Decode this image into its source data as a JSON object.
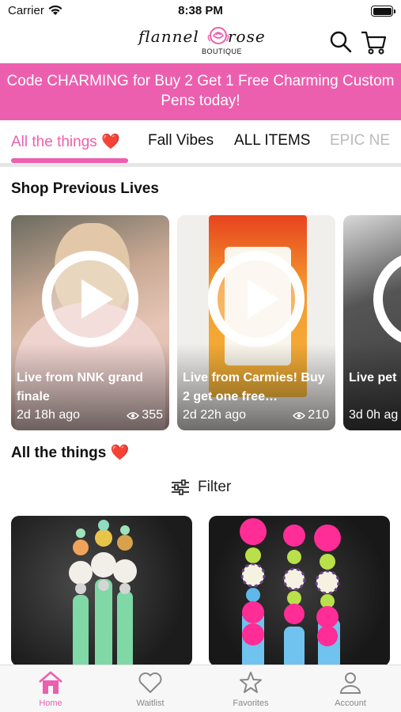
{
  "status_bar": {
    "carrier": "Carrier",
    "time": "8:38 PM"
  },
  "header": {
    "logo": {
      "left": "flannel",
      "right": "rose",
      "sub": "BOUTIQUE"
    }
  },
  "promo": {
    "text": "Code CHARMING for Buy 2 Get 1 Free Charming Custom Pens today!"
  },
  "tabs": [
    {
      "label": "All the things ❤️",
      "active": true
    },
    {
      "label": "Fall Vibes"
    },
    {
      "label": "ALL ITEMS"
    },
    {
      "label": "EPIC NE"
    }
  ],
  "previous_lives": {
    "title": "Shop Previous Lives",
    "items": [
      {
        "title": "Live from NNK grand finale",
        "time": "2d 18h ago",
        "views": "355"
      },
      {
        "title": "Live from Carmies! Buy 2 get one free…",
        "time": "2d 22h ago",
        "views": "210"
      },
      {
        "title": "Live pet",
        "time": "3d 0h ag"
      }
    ]
  },
  "products_section": {
    "title": "All the things ❤️",
    "filter_label": "Filter"
  },
  "bottom_nav": [
    {
      "label": "Home",
      "active": true
    },
    {
      "label": "Waitlist"
    },
    {
      "label": "Favorites"
    },
    {
      "label": "Account"
    }
  ],
  "colors": {
    "accent": "#ec5fae"
  }
}
